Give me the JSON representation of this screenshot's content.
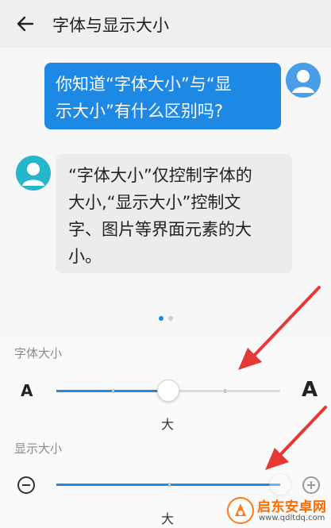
{
  "header": {
    "title": "字体与显示大小"
  },
  "preview": {
    "question_line1": "你知道“字体大小”与“显",
    "question_line2": "示大小”有什么区别吗?",
    "answer_line1": "“字体大小”仅控制字体的",
    "answer_line2": "大小,“显示大小”控制文",
    "answer_line3": "字、图片等界面元素的大",
    "answer_line4": "小。",
    "page_indicator": {
      "count": 2,
      "active": 0
    }
  },
  "font_size": {
    "label": "字体大小",
    "small_glyph": "A",
    "large_glyph": "A",
    "value_label": "大",
    "level_fraction": 0.5
  },
  "display_size": {
    "label": "显示大小",
    "value_label": "大",
    "level_fraction": 1.0
  },
  "icons": {
    "back": "arrow-left-icon",
    "minus": "minus-circle-icon",
    "plus": "plus-circle-icon",
    "avatar": "user-avatar-icon"
  },
  "colors": {
    "accent": "#1e88e5",
    "annotation_arrow": "#e53935",
    "watermark": "#ff6a00"
  },
  "watermark": {
    "brand": "启东安卓网",
    "url": "www.qdltdq.com"
  }
}
